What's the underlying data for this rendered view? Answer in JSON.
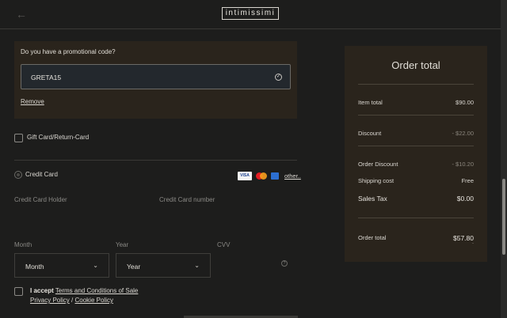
{
  "header": {
    "back_icon": "←",
    "logo": "intimissimi"
  },
  "promo": {
    "question": "Do you have a promotional code?",
    "code_value": "GRETA15",
    "check_icon": "✓",
    "remove_label": "Remove"
  },
  "gift": {
    "label": "Gift Card/Return-Card"
  },
  "payment": {
    "credit_card_label": "Credit Card",
    "card_logos": {
      "visa": "VISA",
      "other": "other.."
    },
    "holder_label": "Credit Card Holder",
    "number_label": "Credit Card number",
    "month_label": "Month",
    "month_value": "Month",
    "year_label": "Year",
    "year_value": "Year",
    "cvv_label": "CVV",
    "chevron": "⌄"
  },
  "terms": {
    "accept": "I accept",
    "terms_link": "Terms and Conditions of Sale",
    "privacy_link": "Privacy Policy",
    "separator": "/",
    "cookie_link": "Cookie Policy"
  },
  "order": {
    "title": "Order total",
    "item_total_label": "Item total",
    "item_total_value": "$90.00",
    "discount_label": "Discount",
    "discount_value": "- $22.00",
    "order_discount_label": "Order Discount",
    "order_discount_value": "- $10.20",
    "shipping_label": "Shipping cost",
    "shipping_value": "Free",
    "tax_label": "Sales Tax",
    "tax_value": "$0.00",
    "total_label": "Order total",
    "total_value": "$57.80",
    "total_sub": "-"
  },
  "colors": {
    "background": "#1d1d1c",
    "panel": "#2a241c",
    "input_bg": "#23282d"
  }
}
